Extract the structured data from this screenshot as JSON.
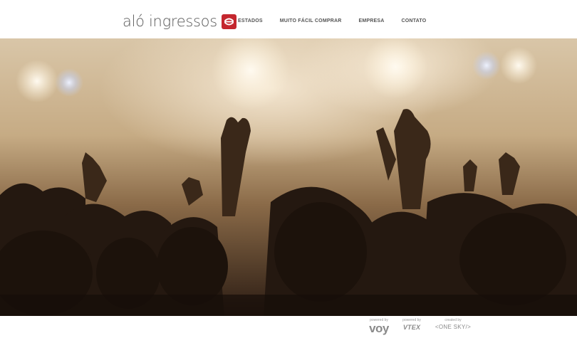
{
  "brand": {
    "name": "aló ingressos",
    "icon": "ticket-logo-icon",
    "accent": "#c4262e"
  },
  "nav": {
    "items": [
      {
        "label": "ESTADOS"
      },
      {
        "label": "MUITO FÁCIL COMPRAR"
      },
      {
        "label": "EMPRESA"
      },
      {
        "label": "CONTATO"
      }
    ]
  },
  "hero": {
    "image": "concert-crowd-photo"
  },
  "footer": {
    "credits": [
      {
        "caption": "powered by",
        "logo": "voy"
      },
      {
        "caption": "powered by",
        "logo": "VTEX"
      },
      {
        "caption": "created by",
        "logo": "<ONE SKY/>"
      }
    ]
  }
}
